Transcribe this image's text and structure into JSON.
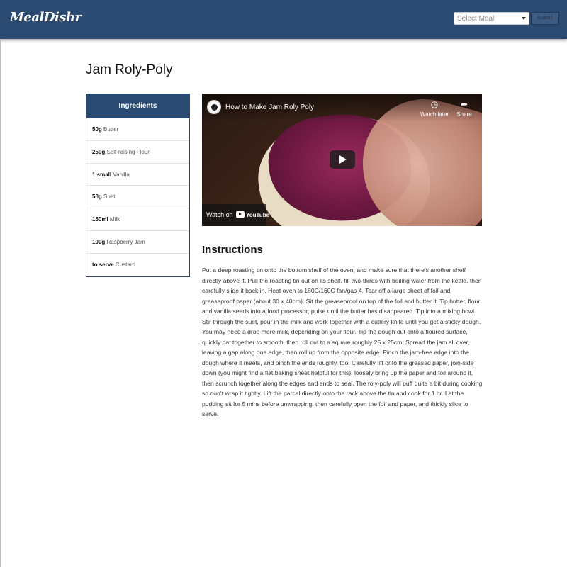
{
  "navbar": {
    "brand": "MealDishr",
    "select_placeholder": "Select Meal",
    "submit_label": "SUBMIT",
    "color": "#2a4a72"
  },
  "meal": {
    "title": "Jam Roly-Poly"
  },
  "ingredients": {
    "header": "Ingredients",
    "items": [
      {
        "qty": "50g",
        "name": "Butter"
      },
      {
        "qty": "250g",
        "name": "Self-raising Flour"
      },
      {
        "qty": "1 small",
        "name": "Vanilla"
      },
      {
        "qty": "50g",
        "name": "Suet"
      },
      {
        "qty": "150ml",
        "name": "Milk"
      },
      {
        "qty": "100g",
        "name": "Raspberry Jam"
      },
      {
        "qty": "to serve",
        "name": "Custard"
      }
    ]
  },
  "video": {
    "title": "How to Make Jam Roly Poly",
    "watch_later": "Watch later",
    "share": "Share",
    "watch_on": "Watch on",
    "youtube": "YouTube",
    "icons": {
      "watch_later": "clock-icon",
      "share": "share-icon",
      "play": "play-icon",
      "channel": "channel-logo-icon"
    }
  },
  "instructions": {
    "title": "Instructions",
    "text": "Put a deep roasting tin onto the bottom shelf of the oven, and make sure that there’s another shelf directly above it. Pull the roasting tin out on its shelf, fill two-thirds with boiling water from the kettle, then carefully slide it back in. Heat oven to 180C/160C fan/gas 4. Tear off a large sheet of foil and greaseproof paper (about 30 x 40cm). Sit the greaseproof on top of the foil and butter it. Tip butter, flour and vanilla seeds into a food processor; pulse until the butter has disappeared. Tip into a mixing bowl. Stir through the suet, pour in the milk and work together with a cutlery knife until you get a sticky dough. You may need a drop more milk, depending on your flour. Tip the dough out onto a floured surface, quickly pat together to smooth, then roll out to a square roughly 25 x 25cm. Spread the jam all over, leaving a gap along one edge, then roll up from the opposite edge. Pinch the jam-free edge into the dough where it meets, and pinch the ends roughly, too. Carefully lift onto the greased paper, join-side down (you might find a flat baking sheet helpful for this), loosely bring up the paper and foil around it, then scrunch together along the edges and ends to seal. The roly-poly will puff quite a bit during cooking so don’t wrap it tightly. Lift the parcel directly onto the rack above the tin and cook for 1 hr. Let the pudding sit for 5 mins before unwrapping, then carefully open the foil and paper, and thickly slice to serve."
  }
}
